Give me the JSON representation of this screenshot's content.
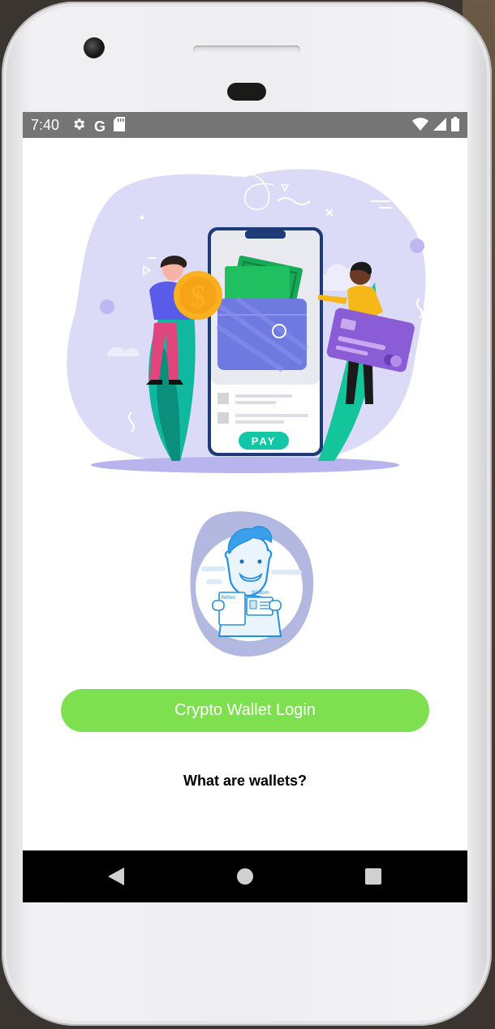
{
  "status_bar": {
    "time": "7:40",
    "left_icons": [
      "settings-icon",
      "google-icon",
      "sd-card-icon"
    ],
    "google_letter": "G",
    "right_icons": [
      "wifi-icon",
      "signal-icon",
      "battery-icon"
    ]
  },
  "hero": {
    "pay_label": "PAY"
  },
  "avatar": {
    "card_label_1": "Bitfrex",
    "card_label_2": "Wisdom"
  },
  "actions": {
    "login_label": "Crypto Wallet Login",
    "help_link": "What are wallets?"
  },
  "nav": [
    "back-icon",
    "home-icon",
    "recents-icon"
  ],
  "colors": {
    "status_bar": "#757575",
    "login_button": "#7ee04f",
    "nav_bar": "#000000",
    "blob": "#d8d7f5",
    "wallet": "#6f7ae0",
    "pay_button": "#13c6a5"
  }
}
